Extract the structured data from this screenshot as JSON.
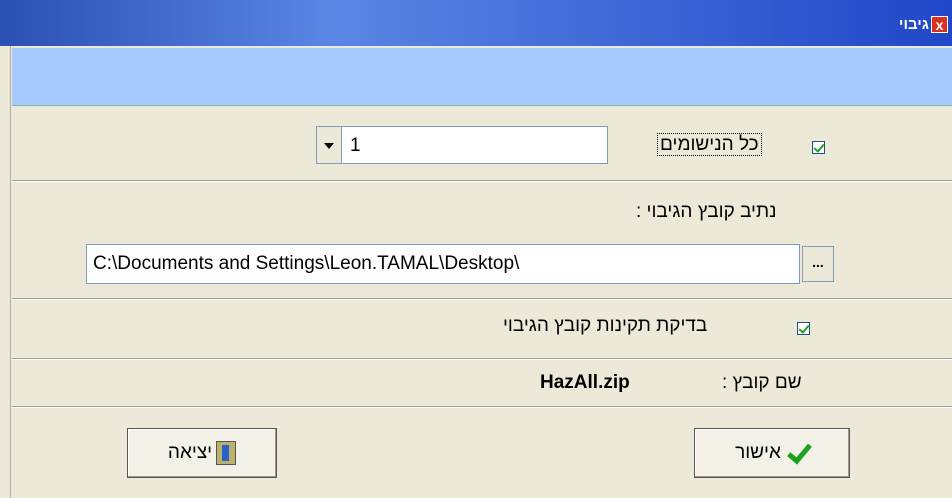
{
  "window": {
    "title": "גיבוי",
    "close_icon": "close-icon"
  },
  "all_records": {
    "label": "כל הנישומים",
    "checked": true
  },
  "count_combo": {
    "value": "1"
  },
  "backup_path": {
    "label": "נתיב קובץ הגיבוי :",
    "value": "C:\\Documents and Settings\\Leon.TAMAL\\Desktop\\",
    "browse_label": "..."
  },
  "verify": {
    "label": "בדיקת תקינות קובץ הגיבוי",
    "checked": true
  },
  "file_name": {
    "label": "שם קובץ :",
    "value": "HazAll.zip"
  },
  "buttons": {
    "ok_label": "אישור",
    "exit_label": "יציאה"
  },
  "colors": {
    "title_bar": "#2a4fb5",
    "banner": "#a6cafe",
    "dialog_bg": "#ece9d8",
    "check": "#21a121"
  }
}
